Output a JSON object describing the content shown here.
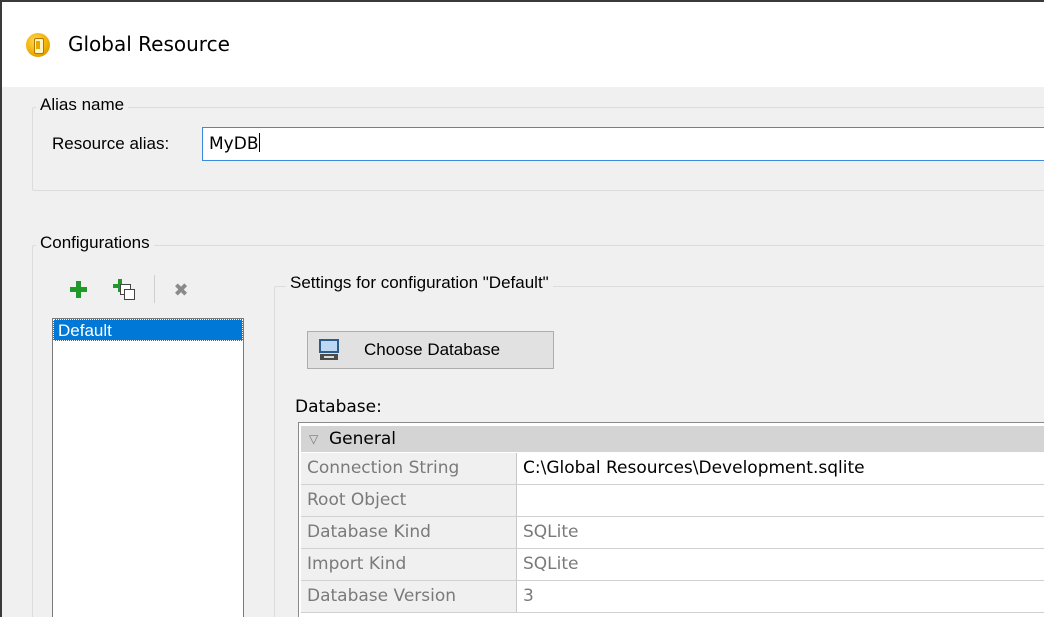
{
  "window": {
    "title": "Global Resource"
  },
  "alias": {
    "group_label": "Alias name",
    "field_label": "Resource alias:",
    "value": "MyDB"
  },
  "configurations": {
    "group_label": "Configurations",
    "toolbar": {
      "add_icon": "plus-icon",
      "copy_icon": "add-copy-icon",
      "delete_icon": "delete-icon"
    },
    "items": [
      {
        "label": "Default",
        "selected": true
      }
    ]
  },
  "settings": {
    "group_label": "Settings for configuration \"Default\"",
    "choose_button": "Choose Database",
    "database_label": "Database:",
    "grid": {
      "section": "General",
      "rows": [
        {
          "key": "Connection String",
          "value": "C:\\Global Resources\\Development.sqlite"
        },
        {
          "key": "Root Object",
          "value": ""
        },
        {
          "key": "Database Kind",
          "value": "SQLite"
        },
        {
          "key": "Import Kind",
          "value": "SQLite"
        },
        {
          "key": "Database Version",
          "value": "3"
        }
      ]
    }
  },
  "colors": {
    "selection": "#0078d7",
    "focus_border": "#3a8be0",
    "add_green": "#1f9a2a"
  }
}
